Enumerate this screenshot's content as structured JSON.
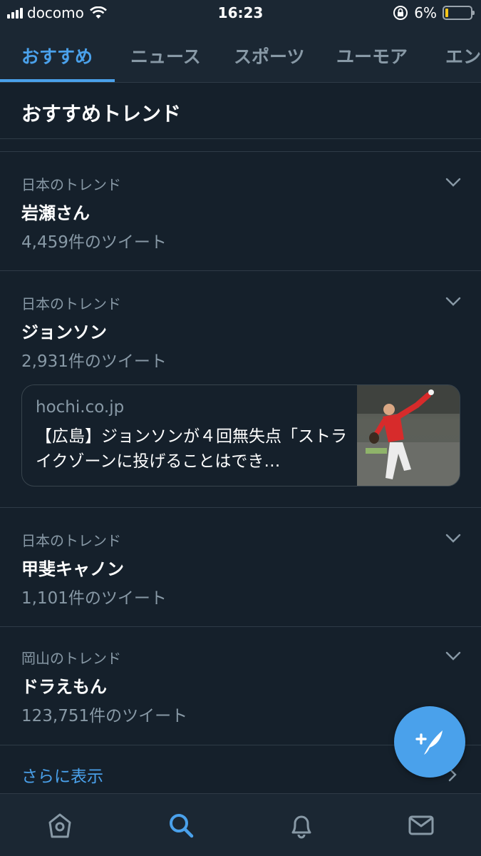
{
  "status_bar": {
    "carrier": "docomo",
    "time": "16:23",
    "battery": "6%",
    "battery_level_fraction": 0.06,
    "battery_color": "#f5c518"
  },
  "tabs": [
    {
      "label": "おすすめ",
      "active": true
    },
    {
      "label": "ニュース",
      "active": false
    },
    {
      "label": "スポーツ",
      "active": false
    },
    {
      "label": "ユーモア",
      "active": false
    },
    {
      "label": "エン",
      "active": false
    }
  ],
  "section": {
    "title": "おすすめトレンド"
  },
  "trends": [
    {
      "context": "日本のトレンド",
      "name": "岩瀬さん",
      "count": "4,459件のツイート"
    },
    {
      "context": "日本のトレンド",
      "name": "ジョンソン",
      "count": "2,931件のツイート",
      "card": {
        "domain": "hochi.co.jp",
        "headline": "【広島】ジョンソンが４回無失点「ストライクゾーンに投げることはでき…"
      }
    },
    {
      "context": "日本のトレンド",
      "name": "甲斐キャノン",
      "count": "1,101件のツイート"
    },
    {
      "context": "岡山のトレンド",
      "name": "ドラえもん",
      "count": "123,751件のツイート"
    }
  ],
  "show_more": {
    "label": "さらに表示"
  },
  "fab": {
    "icon": "compose-tweet-icon"
  },
  "bottom_nav": [
    {
      "icon": "home-icon",
      "active": false
    },
    {
      "icon": "search-icon",
      "active": true
    },
    {
      "icon": "bell-icon",
      "active": false
    },
    {
      "icon": "mail-icon",
      "active": false
    }
  ],
  "colors": {
    "background": "#15202b",
    "bar": "#1b2733",
    "accent": "#4aa1eb",
    "muted_text": "#8899a6",
    "divider": "#2f3b47"
  }
}
